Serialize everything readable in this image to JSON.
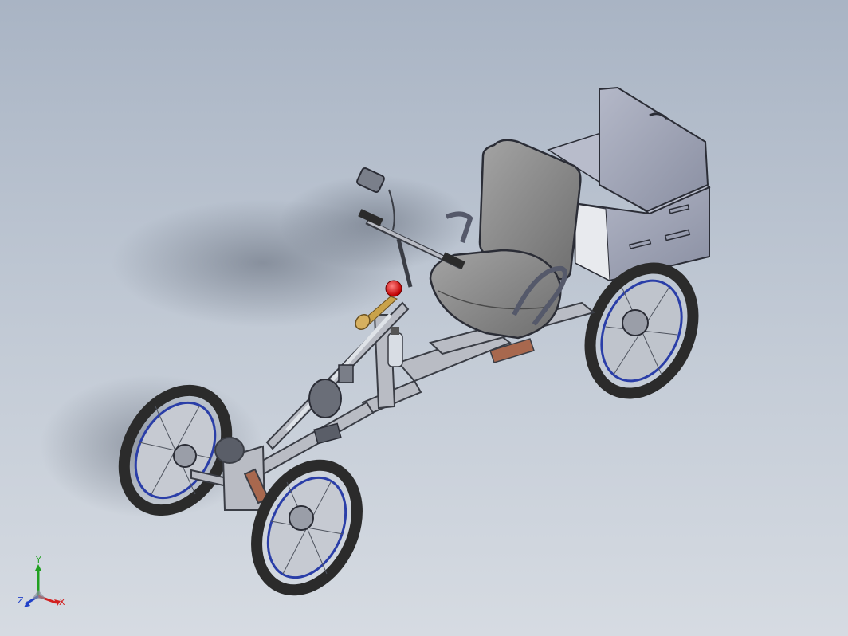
{
  "viewport": {
    "background_top": "#a9b4c4",
    "background_bottom": "#d6dbe2"
  },
  "triad": {
    "x_label": "X",
    "y_label": "Y",
    "z_label": "Z",
    "x_color": "#d22020",
    "y_color": "#20a020",
    "z_color": "#2040c8"
  },
  "model": {
    "frame_color": "#b9bcc4",
    "panel_color": "#9ea3b4",
    "seat_color": "#8c8c8c",
    "tire_color": "#2b2b2b",
    "rim_accent_color": "#2a3ea8",
    "horn_bulb_color": "#e01818",
    "horn_brass_color": "#c9a24a",
    "accent_rust_color": "#a8684e"
  }
}
